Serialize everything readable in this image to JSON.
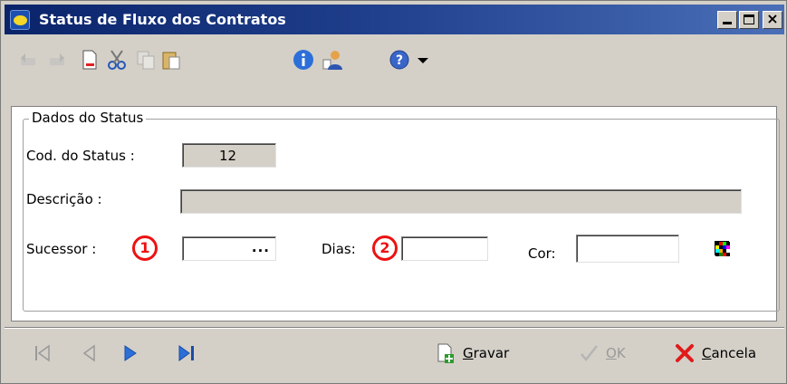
{
  "window": {
    "title": "Status de Fluxo dos Contratos"
  },
  "toolbar": {
    "items": [
      {
        "icon": "undo-icon",
        "enabled": false
      },
      {
        "icon": "redo-icon",
        "enabled": false
      },
      {
        "icon": "new-document-icon",
        "enabled": true
      },
      {
        "icon": "scissors-icon",
        "enabled": true
      },
      {
        "icon": "copy-icon",
        "enabled": true
      },
      {
        "icon": "paste-icon",
        "enabled": true
      },
      {
        "icon": "info-icon",
        "enabled": true
      },
      {
        "icon": "user-icon",
        "enabled": true
      },
      {
        "icon": "help-icon",
        "enabled": true
      },
      {
        "icon": "dropdown-arrow-icon",
        "enabled": true
      }
    ]
  },
  "form": {
    "group_title": "Dados do Status",
    "cod_label": "Cod. do Status :",
    "cod_value": "12",
    "descricao_label": "Descrição :",
    "descricao_value": "",
    "sucessor_label": "Sucessor :",
    "sucessor_value": "",
    "sucessor_lookup": "...",
    "dias_label": "Dias:",
    "dias_value": "",
    "cor_label": "Cor:",
    "cor_value": "",
    "badge_1": "1",
    "badge_2": "2"
  },
  "navigation": {
    "items": [
      "first-record-icon",
      "previous-record-icon",
      "next-record-icon",
      "last-record-icon"
    ]
  },
  "actions": {
    "gravar_prefix": "G",
    "gravar_rest": "ravar",
    "ok_prefix": "O",
    "ok_rest": "K",
    "cancela_prefix": "C",
    "cancela_rest": "ancela"
  },
  "colors": {
    "title_bar": "#0a246a",
    "window_bg": "#d4d0c8",
    "badge": "#ee1111",
    "nav_active": "#2c6fd6"
  }
}
